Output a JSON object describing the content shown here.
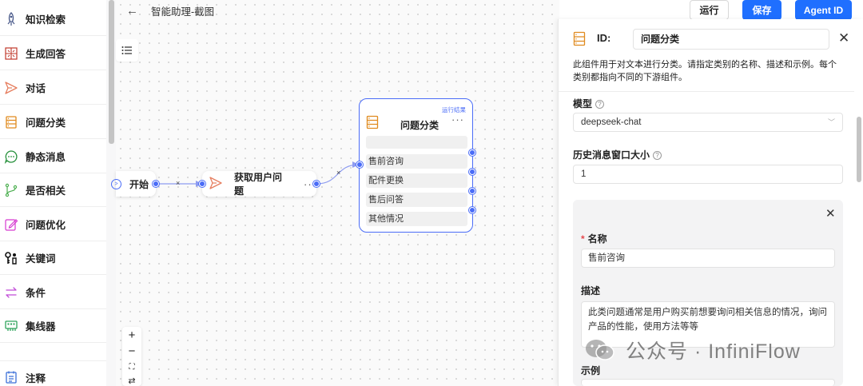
{
  "sidebar": {
    "items": [
      {
        "label": "知识检索",
        "icon": "rocket-icon"
      },
      {
        "label": "生成回答",
        "icon": "generate-icon"
      },
      {
        "label": "对话",
        "icon": "send-icon"
      },
      {
        "label": "问题分类",
        "icon": "classify-icon"
      },
      {
        "label": "静态消息",
        "icon": "message-icon"
      },
      {
        "label": "是否相关",
        "icon": "branch-icon"
      },
      {
        "label": "问题优化",
        "icon": "edit-icon"
      },
      {
        "label": "关键词",
        "icon": "keyword-icon"
      },
      {
        "label": "条件",
        "icon": "switch-icon"
      },
      {
        "label": "集线器",
        "icon": "hub-icon"
      },
      {
        "label": "注释",
        "icon": "note-icon"
      }
    ]
  },
  "header": {
    "title": "智能助理-截图"
  },
  "toolbar": {
    "run_label": "运行",
    "save_label": "保存",
    "agent_id_label": "Agent ID"
  },
  "canvas": {
    "nodes": {
      "start": {
        "label": "开始"
      },
      "get_question": {
        "label": "获取用户问题"
      },
      "classify": {
        "label": "问题分类",
        "run_result": "运行结果",
        "categories": [
          "售前咨询",
          "配件更换",
          "售后问答",
          "其他情况"
        ]
      }
    },
    "edge_label": "×",
    "zoom": {
      "in": "+",
      "out": "−",
      "fit": "⛶"
    }
  },
  "panel": {
    "id_label": "ID:",
    "id_value": "问题分类",
    "description": "此组件用于对文本进行分类。请指定类别的名称、描述和示例。每个类别都指向不同的下游组件。",
    "model_label": "模型",
    "model_value": "deepseek-chat",
    "history_label": "历史消息窗口大小",
    "history_value": "1",
    "category_card": {
      "name_label": "名称",
      "name_value": "售前咨询",
      "desc_label": "描述",
      "desc_value": "此类问题通常是用户购买前想要询问相关信息的情况，询问产品的性能，使用方法等等",
      "example_label": "示例"
    }
  },
  "watermark": {
    "text": "公众号 · InfiniFlow"
  },
  "colors": {
    "accent": "#4a6cf7",
    "primary_button": "#1f6fff"
  }
}
